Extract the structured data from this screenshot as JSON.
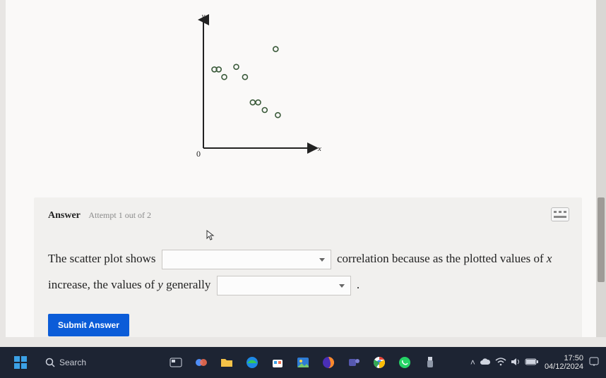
{
  "chart_data": {
    "type": "scatter",
    "xlabel": "x",
    "ylabel": "y",
    "origin_label": "0",
    "xlim": [
      0,
      10
    ],
    "ylim": [
      0,
      10
    ],
    "points": [
      {
        "x": 1.0,
        "y": 6.2
      },
      {
        "x": 1.4,
        "y": 6.2
      },
      {
        "x": 1.9,
        "y": 5.6
      },
      {
        "x": 3.0,
        "y": 6.4
      },
      {
        "x": 3.8,
        "y": 5.6
      },
      {
        "x": 4.5,
        "y": 3.6
      },
      {
        "x": 5.0,
        "y": 3.6
      },
      {
        "x": 5.6,
        "y": 3.0
      },
      {
        "x": 6.6,
        "y": 7.8
      },
      {
        "x": 6.8,
        "y": 2.6
      }
    ]
  },
  "answer": {
    "label": "Answer",
    "attempt": "Attempt 1 out of 2",
    "sentence": {
      "part1": "The scatter plot shows",
      "part2": "correlation because as the plotted values of",
      "var1": "x",
      "part3": "increase, the values of",
      "var2": "y",
      "part4": "generally",
      "dropdown1_value": "",
      "dropdown2_value": ""
    },
    "submit": "Submit Answer"
  },
  "taskbar": {
    "search_placeholder": "Search",
    "time": "17:50",
    "date": "04/12/2024"
  }
}
